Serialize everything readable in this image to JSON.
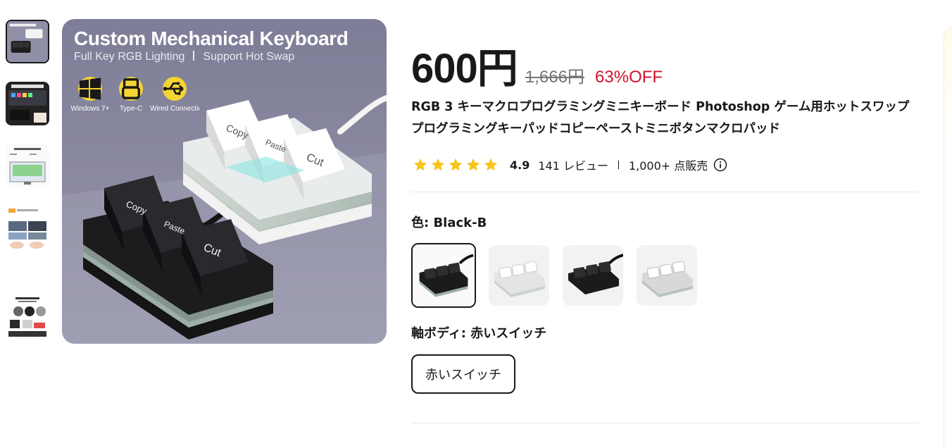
{
  "colors": {
    "accent_red": "#d2122e",
    "star_yellow": "#f5c518",
    "text": "#191919",
    "muted": "#757575",
    "hero_bg": "#8a8aa2"
  },
  "gallery": {
    "thumbnails": [
      {
        "name": "thumb-keyboard-black-white",
        "active": true
      },
      {
        "name": "thumb-productivity-tool"
      },
      {
        "name": "thumb-software-screen"
      },
      {
        "name": "thumb-features-collage"
      },
      {
        "name": "thumb-mechanical-key-switch"
      }
    ],
    "hero": {
      "headline": "Custom Mechanical Keyboard",
      "subline_left": "Full Key RGB Lighting",
      "subline_right": "Support Hot Swap",
      "features": [
        {
          "icon": "windows-icon",
          "label": "Windows 7+"
        },
        {
          "icon": "usb-c-icon",
          "label": "Type-C"
        },
        {
          "icon": "usb-icon",
          "label": "Wired Connection"
        }
      ],
      "keycaps_white": [
        "Copy",
        "Paste",
        "Cut"
      ],
      "keycaps_black": [
        "Copy",
        "Paste",
        "Cut"
      ]
    }
  },
  "product": {
    "price": "600円",
    "original_price": "1,666円",
    "discount": "63%OFF",
    "title": "RGB 3 キーマクロプログラミングミニキーボード Photoshop ゲーム用ホットスワッププログラミングキーパッドコピーペーストミニボタンマクロパッド",
    "rating": {
      "stars": 5,
      "score": "4.9",
      "reviews": "141 レビュー",
      "sold": "1,000+ 点販売"
    },
    "color_option": {
      "label": "色: Black-B",
      "swatches": [
        {
          "name": "Black-B",
          "selected": true
        },
        {
          "name": "White"
        },
        {
          "name": "Black"
        },
        {
          "name": "White-B"
        }
      ]
    },
    "switch_option": {
      "label": "軸ボディ: 赤いスイッチ",
      "choices": [
        "赤いスイッチ"
      ]
    }
  }
}
